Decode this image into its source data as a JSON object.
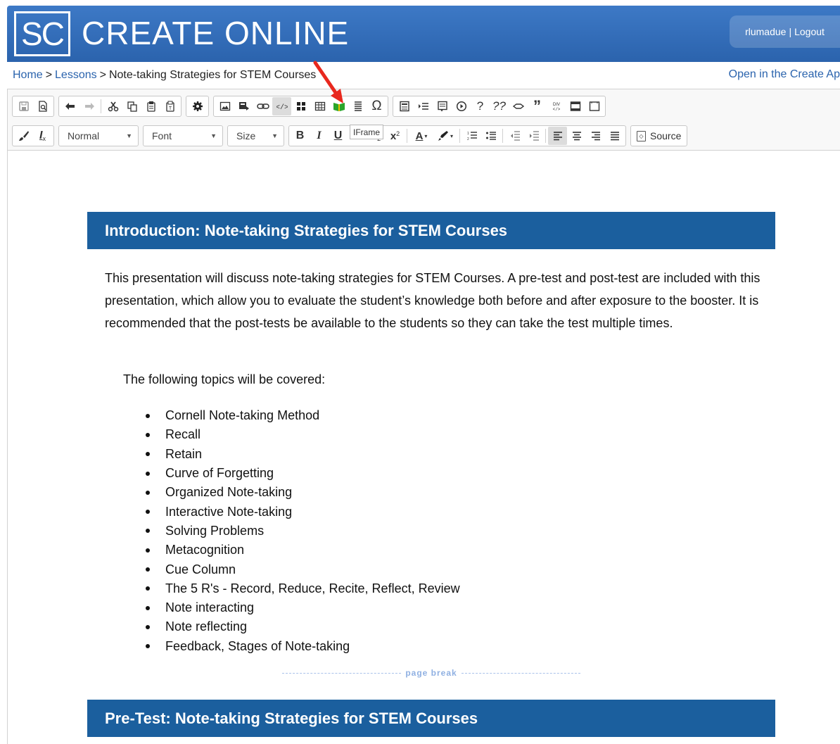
{
  "header": {
    "logo_text": "SC",
    "title": "CREATE ONLINE",
    "username": "rlumadue",
    "user_sep": "|",
    "logout": "Logout"
  },
  "breadcrumb": {
    "home": "Home",
    "sep": ">",
    "lessons": "Lessons",
    "current": "Note-taking Strategies for STEM Courses",
    "open_app": "Open in the Create Ap"
  },
  "toolbar": {
    "format_combo": "Normal",
    "font_combo": "Font",
    "size_combo": "Size",
    "source_label": "Source",
    "tooltip": "IFrame",
    "row1_icons": [
      "save-icon",
      "preview-icon",
      "undo-icon",
      "redo-icon",
      "cut-icon",
      "copy-icon",
      "paste-icon",
      "paste-text-icon",
      "settings-icon",
      "image-icon",
      "media-icon",
      "link-icon",
      "iframe-icon",
      "widget-icon",
      "table-icon",
      "book-icon",
      "align-justify-icon",
      "omega-icon",
      "template-icon",
      "list-indent-icon",
      "note-icon",
      "play-icon",
      "help-icon",
      "double-help-icon",
      "link-chain-icon",
      "quote-icon",
      "div-icon",
      "div-container-icon",
      "frame-icon",
      "blank-page-icon"
    ],
    "row2_icons": [
      "brush-icon",
      "clear-format-icon",
      "bold-icon",
      "italic-icon",
      "underline-icon",
      "strikethrough-icon",
      "subscript-icon",
      "superscript-icon",
      "text-color-icon",
      "highlight-icon",
      "ordered-list-icon",
      "bullet-list-icon",
      "outdent-icon",
      "indent-icon",
      "align-left-icon",
      "align-center-icon",
      "align-right-icon",
      "align-justify-icon"
    ]
  },
  "content": {
    "heading1": "Introduction: Note-taking Strategies for STEM Courses",
    "intro_paragraph": "This presentation will discuss note-taking strategies for STEM Courses.  A pre-test and post-test are included with this presentation, which allow you to evaluate the student’s knowledge both before and after exposure to the booster. It is recommended that the post-tests be available to the students so they can take the test multiple times.",
    "topics_intro": "The following topics will be covered:",
    "topics": [
      "Cornell Note-taking Method",
      "Recall",
      "Retain",
      "Curve of Forgetting",
      "Organized Note-taking",
      "Interactive Note-taking",
      "Solving Problems",
      "Metacognition",
      "Cue Column",
      "The 5 R's - Record, Reduce, Recite, Reflect, Review",
      "Note interacting",
      "Note reflecting",
      "Feedback, Stages of Note-taking"
    ],
    "page_break": "page break",
    "heading2": "Pre-Test: Note-taking Strategies for STEM Courses"
  },
  "colors": {
    "header_blue": "#2b63ad",
    "banner_blue": "#1b5f9e",
    "link_blue": "#2a63ad",
    "arrow_red": "#e8281e"
  }
}
